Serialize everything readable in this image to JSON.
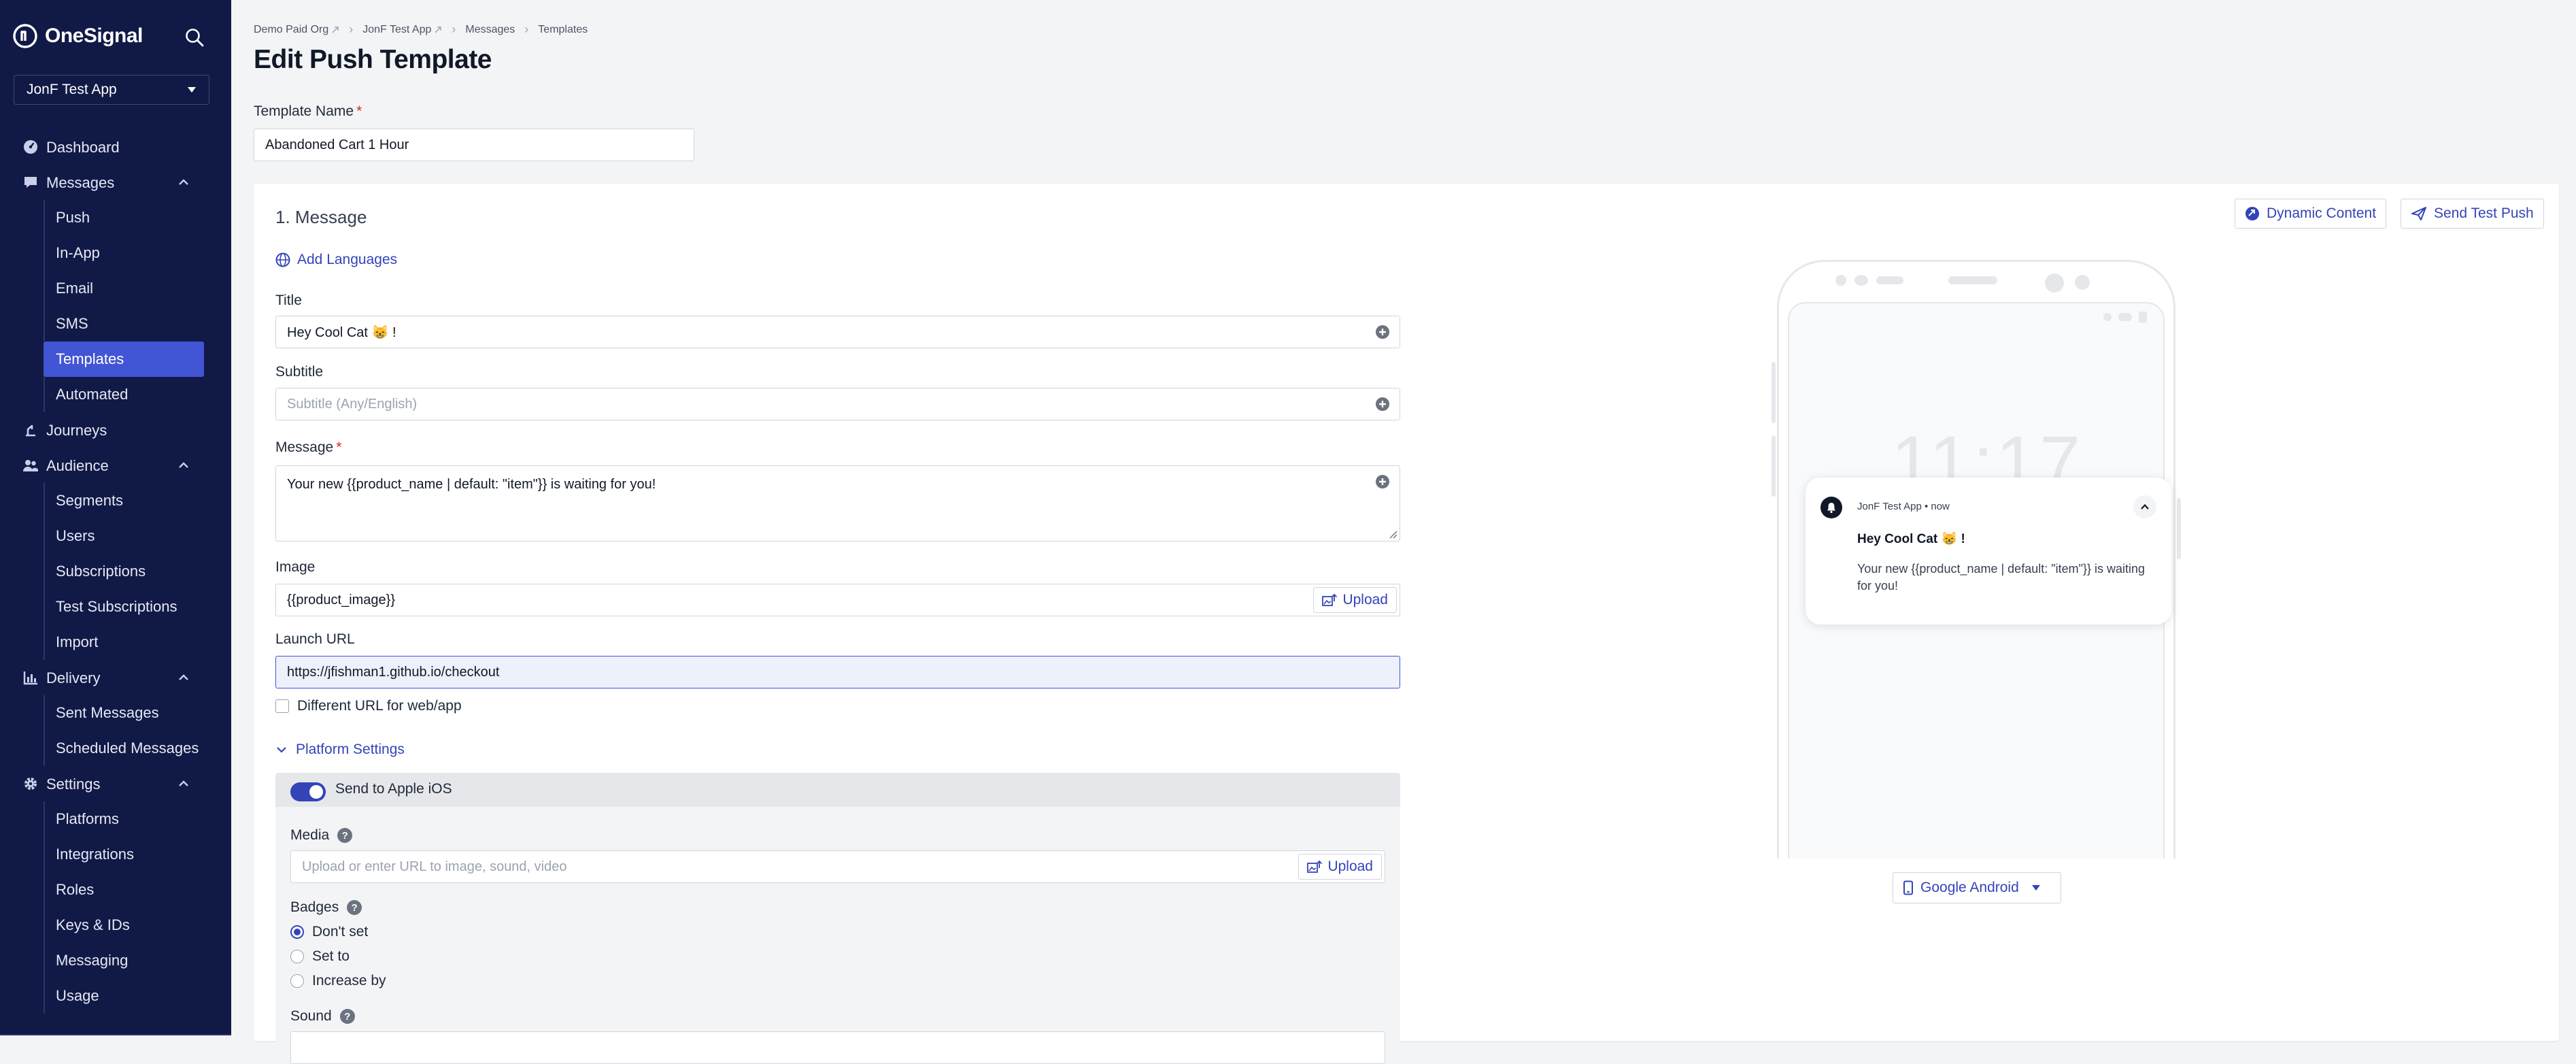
{
  "brand": {
    "name": "OneSignal"
  },
  "sidebar": {
    "app_selector": "JonF Test App",
    "nav": [
      {
        "label": "Dashboard",
        "icon": "dashboard-icon"
      },
      {
        "label": "Messages",
        "icon": "chat-icon",
        "expanded": true,
        "children": [
          "Push",
          "In-App",
          "Email",
          "SMS",
          "Templates",
          "Automated"
        ]
      },
      {
        "label": "Journeys",
        "icon": "journeys-icon"
      },
      {
        "label": "Audience",
        "icon": "people-icon",
        "expanded": true,
        "children": [
          "Segments",
          "Users",
          "Subscriptions",
          "Test Subscriptions",
          "Import"
        ]
      },
      {
        "label": "Delivery",
        "icon": "bar-chart-icon",
        "expanded": true,
        "children": [
          "Sent Messages",
          "Scheduled Messages"
        ]
      },
      {
        "label": "Settings",
        "icon": "gear-icon",
        "expanded": true,
        "children": [
          "Platforms",
          "Integrations",
          "Roles",
          "Keys & IDs",
          "Messaging",
          "Usage"
        ]
      }
    ],
    "active_item": "Templates"
  },
  "breadcrumb": [
    "Demo Paid Org",
    "JonF Test App",
    "Messages",
    "Templates"
  ],
  "page": {
    "title": "Edit Push Template",
    "template_name_label": "Template Name",
    "template_name_value": "Abandoned Cart 1 Hour"
  },
  "message": {
    "section_title": "1. Message",
    "dynamic_content_label": "Dynamic Content",
    "send_test_label": "Send Test Push",
    "add_languages_label": "Add Languages",
    "title_label": "Title",
    "title_value": "Hey Cool Cat 😸 !",
    "subtitle_label": "Subtitle",
    "subtitle_placeholder": "Subtitle (Any/English)",
    "message_label": "Message",
    "message_value": "Your new {{product_name | default: \"item\"}} is waiting for you!",
    "image_label": "Image",
    "image_value": "{{product_image}}",
    "upload_label": "Upload",
    "launch_url_label": "Launch URL",
    "launch_url_value": "https://jfishman1.github.io/checkout",
    "different_url_label": "Different URL for web/app",
    "platform_settings_label": "Platform Settings",
    "ios": {
      "toggle_label": "Send to Apple iOS",
      "enabled": true,
      "media_label": "Media",
      "media_placeholder": "Upload or enter URL to image, sound, video",
      "badges_label": "Badges",
      "badge_options": [
        "Don't set",
        "Set to",
        "Increase by"
      ],
      "badge_selected": "Don't set",
      "sound_label": "Sound"
    }
  },
  "preview": {
    "clock": "11:17",
    "app_line": "JonF Test App • now",
    "title": "Hey Cool Cat 😸 !",
    "message": "Your new {{product_name | default: \"item\"}} is waiting for you!",
    "platform_select": "Google Android"
  },
  "colors": {
    "sidebar_bg": "#111a46",
    "active_nav": "#4255d4",
    "accent": "#3344b8",
    "required": "#dc2626"
  }
}
